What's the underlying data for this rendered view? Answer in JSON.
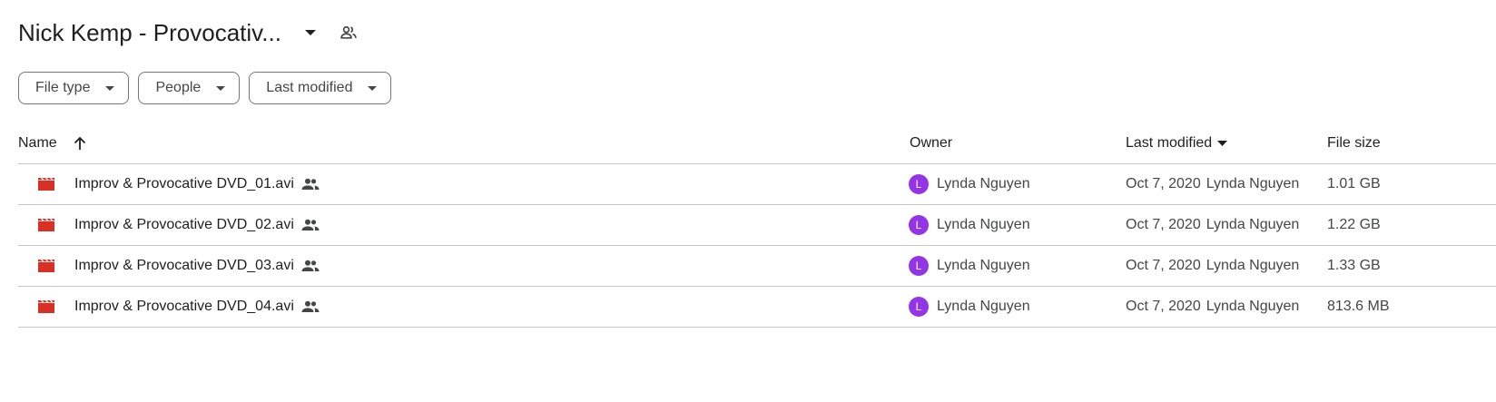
{
  "header": {
    "folder_title": "Nick Kemp - Provocativ..."
  },
  "filters": [
    {
      "label": "File type"
    },
    {
      "label": "People"
    },
    {
      "label": "Last modified"
    }
  ],
  "table": {
    "columns": {
      "name": "Name",
      "owner": "Owner",
      "last_modified": "Last modified",
      "file_size": "File size"
    },
    "rows": [
      {
        "name": "Improv & Provocative DVD_01.avi",
        "owner_initial": "L",
        "owner": "Lynda Nguyen",
        "modified_date": "Oct 7, 2020",
        "modified_by": "Lynda Nguyen",
        "size": "1.01 GB"
      },
      {
        "name": "Improv & Provocative DVD_02.avi",
        "owner_initial": "L",
        "owner": "Lynda Nguyen",
        "modified_date": "Oct 7, 2020",
        "modified_by": "Lynda Nguyen",
        "size": "1.22 GB"
      },
      {
        "name": "Improv & Provocative DVD_03.avi",
        "owner_initial": "L",
        "owner": "Lynda Nguyen",
        "modified_date": "Oct 7, 2020",
        "modified_by": "Lynda Nguyen",
        "size": "1.33 GB"
      },
      {
        "name": "Improv & Provocative DVD_04.avi",
        "owner_initial": "L",
        "owner": "Lynda Nguyen",
        "modified_date": "Oct 7, 2020",
        "modified_by": "Lynda Nguyen",
        "size": "813.6 MB"
      }
    ]
  },
  "colors": {
    "video_icon": "#d93025",
    "avatar": "#9334e6",
    "divider": "#c4c7c5"
  },
  "icons": {
    "file_type": "video-file-icon",
    "shared": "people-icon",
    "title_dropdown": "caret-down-icon",
    "sort": "arrow-up-icon"
  }
}
